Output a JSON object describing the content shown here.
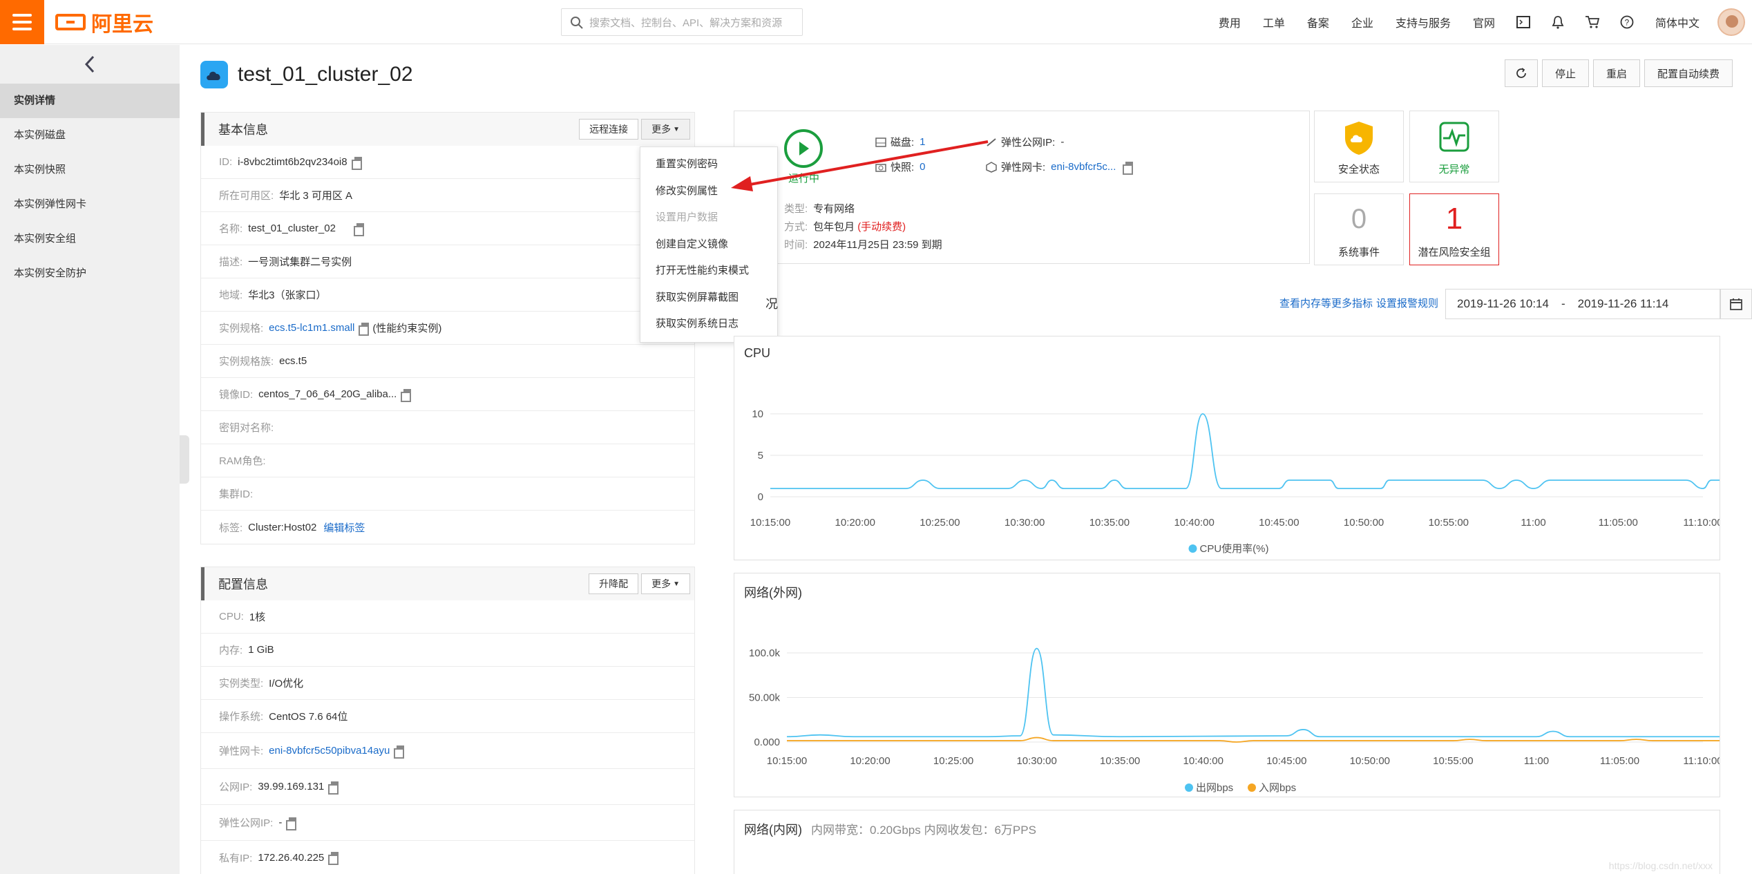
{
  "header": {
    "logo_text": "阿里云",
    "search_placeholder": "搜索文档、控制台、API、解决方案和资源",
    "nav": [
      "费用",
      "工单",
      "备案",
      "企业",
      "支持与服务",
      "官网"
    ],
    "lang": "简体中文"
  },
  "sidebar": {
    "items": [
      {
        "label": "实例详情",
        "active": true
      },
      {
        "label": "本实例磁盘"
      },
      {
        "label": "本实例快照"
      },
      {
        "label": "本实例弹性网卡"
      },
      {
        "label": "本实例安全组"
      },
      {
        "label": "本实例安全防护"
      }
    ]
  },
  "page": {
    "title": "test_01_cluster_02",
    "actions": [
      "停止",
      "重启",
      "配置自动续费"
    ]
  },
  "basic": {
    "title": "基本信息",
    "remote_btn": "远程连接",
    "more_btn": "更多",
    "rows": [
      {
        "label": "ID:",
        "value": "i-8vbc2timt6b2qv234oi8"
      },
      {
        "label": "所在可用区:",
        "value": "华北 3 可用区 A"
      },
      {
        "label": "名称:",
        "value": "test_01_cluster_02"
      },
      {
        "label": "描述:",
        "value": "一号测试集群二号实例"
      },
      {
        "label": "地域:",
        "value": "华北3（张家口）"
      },
      {
        "label": "实例规格:",
        "value": "ecs.t5-lc1m1.small",
        "extra": "(性能约束实例)"
      },
      {
        "label": "实例规格族:",
        "value": "ecs.t5"
      },
      {
        "label": "镜像ID:",
        "value": "centos_7_06_64_20G_aliba..."
      },
      {
        "label": "密钥对名称:",
        "value": ""
      },
      {
        "label": "RAM角色:",
        "value": ""
      },
      {
        "label": "集群ID:",
        "value": ""
      },
      {
        "label": "标签:",
        "value": "Cluster:Host02",
        "extra": "编辑标签"
      }
    ]
  },
  "dropdown": {
    "items": [
      {
        "label": "重置实例密码"
      },
      {
        "label": "修改实例属性"
      },
      {
        "label": "设置用户数据",
        "disabled": true
      },
      {
        "label": "创建自定义镜像"
      },
      {
        "label": "打开无性能约束模式"
      },
      {
        "label": "获取实例屏幕截图"
      },
      {
        "label": "获取实例系统日志"
      }
    ]
  },
  "config": {
    "title": "配置信息",
    "upgrade_btn": "升降配",
    "more_btn": "更多",
    "rows": [
      {
        "label": "CPU:",
        "value": "1核"
      },
      {
        "label": "内存:",
        "value": "1 GiB"
      },
      {
        "label": "实例类型:",
        "value": "I/O优化"
      },
      {
        "label": "操作系统:",
        "value": "CentOS 7.6 64位"
      },
      {
        "label": "弹性网卡:",
        "value": "eni-8vbfcr5c50pibva14ayu"
      },
      {
        "label": "公网IP:",
        "value": "39.99.169.131"
      },
      {
        "label": "弹性公网IP:",
        "value": "-"
      },
      {
        "label": "私有IP:",
        "value": "172.26.40.225"
      }
    ]
  },
  "status": {
    "state": "运行中",
    "disk_label": "磁盘:",
    "disk_value": "1",
    "snapshot_label": "快照:",
    "snapshot_value": "0",
    "eip_label": "弹性公网IP:",
    "eip_value": "-",
    "eni_label": "弹性网卡:",
    "eni_value": "eni-8vbfcr5c...",
    "net_label": "类型:",
    "net_value": "专有网络",
    "pay_label": "方式:",
    "pay_value": "包年包月",
    "pay_extra": "(手动续费)",
    "expire_label": "时间:",
    "expire_value": "2024年11月25日 23:59 到期"
  },
  "cards": {
    "security_label": "安全状态",
    "health_label": "无异常",
    "events_count": "0",
    "events_label": "系统事件",
    "risk_count": "1",
    "risk_label": "潜在风险安全组"
  },
  "monitor": {
    "link1": "查看内存等更多指标",
    "link2": "设置报警规则",
    "date_from": "2019-11-26 10:14",
    "date_sep": "-",
    "date_to": "2019-11-26 11:14",
    "partial_title": "况"
  },
  "colors": {
    "accent": "#ff6a00",
    "cpu": "#4ec3f1",
    "in": "#f5a623",
    "risk": "#e02020",
    "ok": "#1b9e3e",
    "link": "#1a6bc9"
  },
  "chart_data": [
    {
      "type": "line",
      "title": "CPU",
      "x": [
        "10:15:00",
        "10:20:00",
        "10:25:00",
        "10:30:00",
        "10:35:00",
        "10:40:00",
        "10:45:00",
        "10:50:00",
        "10:55:00",
        "11:00",
        "11:05:00",
        "11:10:00"
      ],
      "ylim": [
        0,
        10
      ],
      "yticks": [
        0,
        5,
        10
      ],
      "series": [
        {
          "name": "CPU使用率(%)",
          "color": "#4ec3f1",
          "points": [
            [
              0,
              1
            ],
            [
              8,
              1
            ],
            [
              9,
              2
            ],
            [
              10,
              1
            ],
            [
              14,
              1
            ],
            [
              15,
              2
            ],
            [
              16,
              1
            ],
            [
              16.6,
              2
            ],
            [
              17.3,
              1
            ],
            [
              19.5,
              1
            ],
            [
              20.3,
              2
            ],
            [
              21,
              1
            ],
            [
              24.5,
              1
            ],
            [
              25.5,
              10
            ],
            [
              26.6,
              1
            ],
            [
              30,
              1
            ],
            [
              30.6,
              2
            ],
            [
              33,
              2
            ],
            [
              33.5,
              1
            ],
            [
              36,
              1
            ],
            [
              36.5,
              2
            ],
            [
              42,
              2
            ],
            [
              43,
              1
            ],
            [
              44,
              2
            ],
            [
              45,
              1
            ],
            [
              46,
              2
            ],
            [
              54,
              2
            ],
            [
              55,
              1
            ],
            [
              55.5,
              2
            ],
            [
              57,
              2
            ]
          ]
        }
      ]
    },
    {
      "type": "line",
      "title": "网络(外网)",
      "x": [
        "10:15:00",
        "10:20:00",
        "10:25:00",
        "10:30:00",
        "10:35:00",
        "10:40:00",
        "10:45:00",
        "10:50:00",
        "10:55:00",
        "11:00",
        "11:05:00",
        "11:10:00"
      ],
      "ylim": [
        0,
        100000
      ],
      "yticks": [
        "0.000",
        "50.00k",
        "100.0k"
      ],
      "series": [
        {
          "name": "出网bps",
          "color": "#4ec3f1",
          "points": [
            [
              0,
              6000
            ],
            [
              2,
              8000
            ],
            [
              4,
              6000
            ],
            [
              12,
              6000
            ],
            [
              14,
              7000
            ],
            [
              15,
              105000
            ],
            [
              16,
              8000
            ],
            [
              20,
              6000
            ],
            [
              30,
              7000
            ],
            [
              31,
              14000
            ],
            [
              32,
              6000
            ],
            [
              45,
              6000
            ],
            [
              46,
              12000
            ],
            [
              47,
              6000
            ],
            [
              57,
              6000
            ]
          ]
        },
        {
          "name": "入网bps",
          "color": "#f5a623",
          "points": [
            [
              0,
              1500
            ],
            [
              14,
              1500
            ],
            [
              15,
              5000
            ],
            [
              16,
              1500
            ],
            [
              26,
              1500
            ],
            [
              27,
              0
            ],
            [
              28,
              1500
            ],
            [
              40,
              1500
            ],
            [
              41,
              3000
            ],
            [
              42,
              1500
            ],
            [
              50,
              1500
            ],
            [
              51,
              3000
            ],
            [
              52,
              1500
            ],
            [
              57,
              1500
            ]
          ]
        }
      ]
    },
    {
      "type": "line",
      "title": "网络(内网)",
      "subtitle": "内网带宽：0.20Gbps 内网收发包：6万PPS"
    }
  ],
  "watermark": "https://blog.csdn.net/xxx"
}
